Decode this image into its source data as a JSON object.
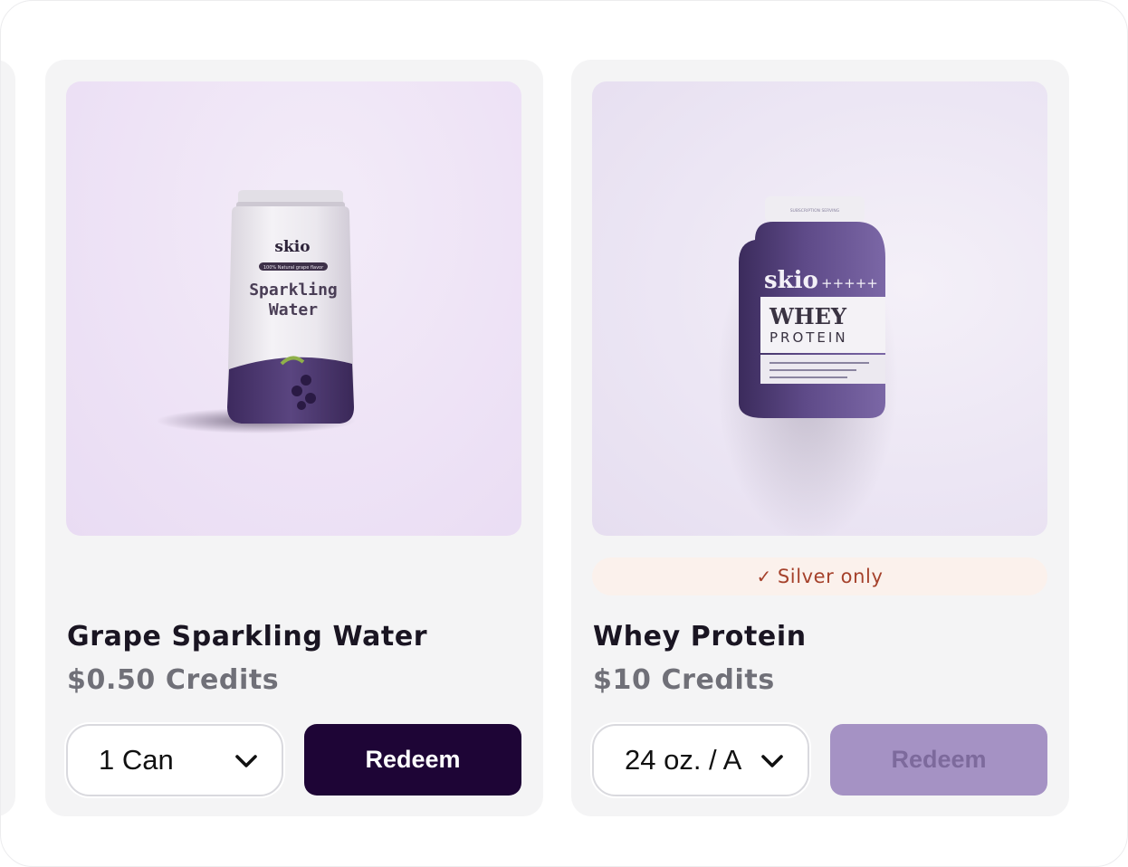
{
  "colors": {
    "card_bg": "#f4f4f5",
    "redeem_active_bg": "#1e0536",
    "redeem_disabled_bg": "#a592c4",
    "badge_bg": "#fbf1ec",
    "badge_text": "#a5412b",
    "brand_purple": "#4e3a73"
  },
  "products": [
    {
      "name": "Grape Sparkling Water",
      "price": "$0.50 Credits",
      "variant": "1 Can",
      "redeem_label": "Redeem",
      "redeem_enabled": true,
      "image": {
        "brand": "skio",
        "tagline": "100% Natural grape flavor",
        "line1": "Sparkling",
        "line2": "Water"
      }
    },
    {
      "name": "Whey Protein",
      "price": "$10 Credits",
      "variant": "24 oz. / A",
      "redeem_label": "Redeem",
      "redeem_enabled": false,
      "badge": {
        "check": "✓",
        "label": "Silver only"
      },
      "image": {
        "brand": "skio",
        "stars": "+++++",
        "line1": "WHEY",
        "line2": "PROTEIN",
        "cap_text": "SUBSCRIPTION SERVING"
      }
    }
  ]
}
